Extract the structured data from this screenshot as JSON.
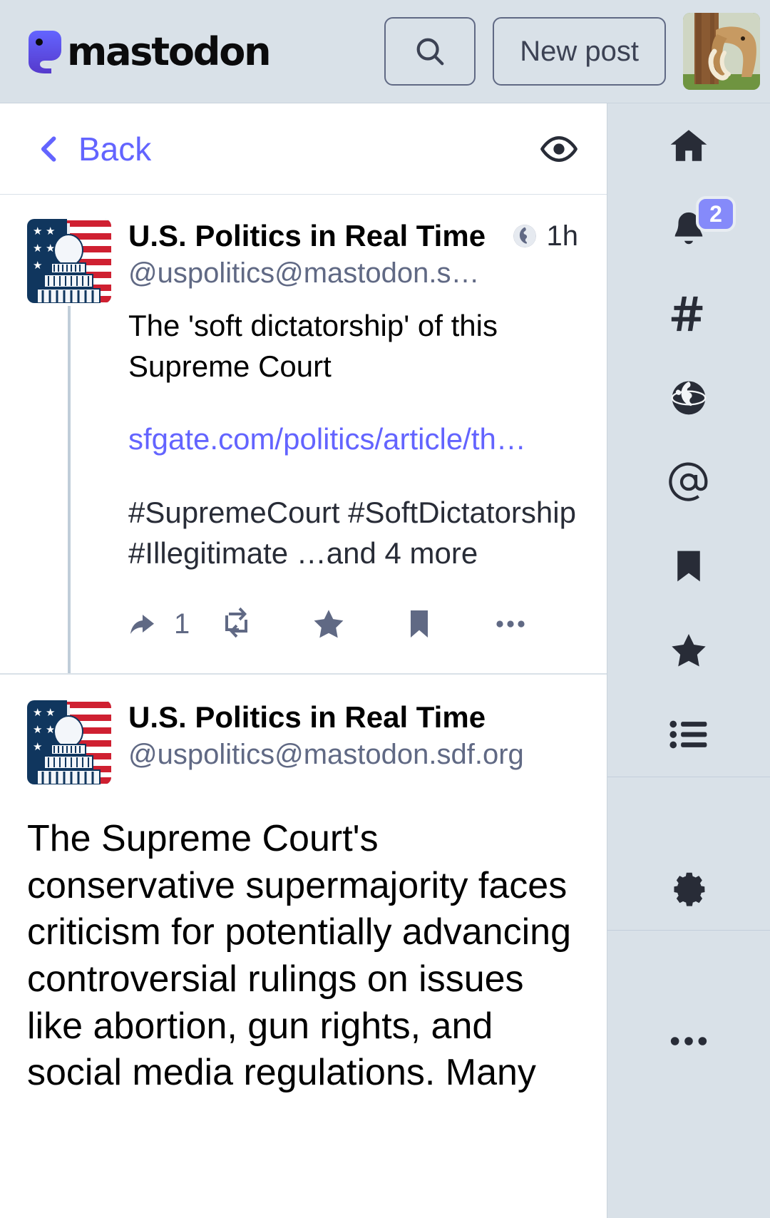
{
  "app": {
    "name": "mastodon",
    "accent_color": "#6364ff",
    "header_bg": "#d9e1e8",
    "icon_color": "#282c37",
    "muted_color": "#606984"
  },
  "topbar": {
    "logo_text": "mastodon",
    "logo_icon": "mastodon-elephant-icon",
    "search_icon": "search-icon",
    "new_post_label": "New post",
    "avatar_icon": "user-avatar-mammoth"
  },
  "column_header": {
    "back_label": "Back",
    "back_icon": "chevron-left-icon",
    "visibility_icon": "eye-icon"
  },
  "statuses": [
    {
      "avatar_icon": "us-capitol-flag-avatar",
      "display_name": "U.S. Politics in Real Time",
      "handle": "@uspolitics@mastodon.s…",
      "visibility_icon": "globe-icon",
      "timestamp": "1h",
      "text_lines": [
        "The 'soft dictatorship' of this Supreme Court"
      ],
      "link_text": "sfgate.com/politics/article/th…",
      "hashtags": "#SupremeCourt #SoftDictatorship #Illegitimate …and 4 more",
      "actions": {
        "reply_icon": "reply-icon",
        "reply_count": "1",
        "boost_icon": "boost-icon",
        "favourite_icon": "star-icon",
        "bookmark_icon": "bookmark-icon",
        "more_icon": "ellipsis-icon"
      }
    },
    {
      "avatar_icon": "us-capitol-flag-avatar",
      "display_name": "U.S. Politics in Real Time",
      "handle": "@uspolitics@mastodon.sdf.org",
      "body": "The Supreme Court's conservative supermajority faces criticism for potentially advancing controversial rulings on issues like abortion, gun rights, and social media regulations. Many"
    }
  ],
  "sidebar": {
    "items": [
      {
        "name": "home",
        "icon": "home-icon"
      },
      {
        "name": "notifications",
        "icon": "bell-icon",
        "badge": "2"
      },
      {
        "name": "hashtags",
        "icon": "hashtag-icon"
      },
      {
        "name": "explore",
        "icon": "globe-icon"
      },
      {
        "name": "mentions",
        "icon": "at-icon"
      },
      {
        "name": "bookmarks",
        "icon": "bookmark-icon"
      },
      {
        "name": "favourites",
        "icon": "star-icon"
      },
      {
        "name": "lists",
        "icon": "list-icon"
      },
      {
        "name": "preferences",
        "icon": "gear-icon"
      },
      {
        "name": "more",
        "icon": "ellipsis-icon"
      }
    ],
    "badge_color": "#858afa"
  }
}
